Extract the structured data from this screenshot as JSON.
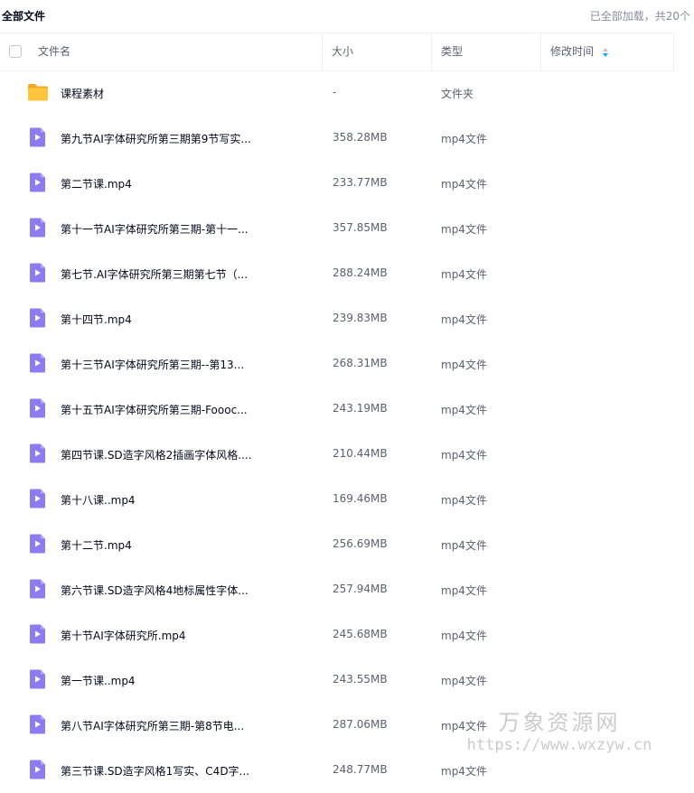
{
  "topbar": {
    "title": "全部文件",
    "loaded_text": "已全部加载，共20个"
  },
  "header": {
    "col_name": "文件名",
    "col_size": "大小",
    "col_type": "类型",
    "col_time": "修改时间"
  },
  "colors": {
    "folder": "#ffc53d",
    "video": "#8c7cf0",
    "sort_active": "#06a7ff"
  },
  "files": [
    {
      "icon": "folder-icon",
      "name": "课程素材",
      "size": "-",
      "type": "文件夹"
    },
    {
      "icon": "video-file-icon",
      "name": "第九节AI字体研究所第三期第9节写实...",
      "size": "358.28MB",
      "type": "mp4文件"
    },
    {
      "icon": "video-file-icon",
      "name": "第二节课.mp4",
      "size": "233.77MB",
      "type": "mp4文件"
    },
    {
      "icon": "video-file-icon",
      "name": "第十一节AI字体研究所第三期-第十一...",
      "size": "357.85MB",
      "type": "mp4文件"
    },
    {
      "icon": "video-file-icon",
      "name": "第七节.AI字体研究所第三期第七节（...",
      "size": "288.24MB",
      "type": "mp4文件"
    },
    {
      "icon": "video-file-icon",
      "name": "第十四节.mp4",
      "size": "239.83MB",
      "type": "mp4文件"
    },
    {
      "icon": "video-file-icon",
      "name": "第十三节AI字体研究所第三期--第13...",
      "size": "268.31MB",
      "type": "mp4文件"
    },
    {
      "icon": "video-file-icon",
      "name": "第十五节AI字体研究所第三期-Foooc...",
      "size": "243.19MB",
      "type": "mp4文件"
    },
    {
      "icon": "video-file-icon",
      "name": "第四节课.SD造字风格2插画字体风格....",
      "size": "210.44MB",
      "type": "mp4文件"
    },
    {
      "icon": "video-file-icon",
      "name": "第十八课..mp4",
      "size": "169.46MB",
      "type": "mp4文件"
    },
    {
      "icon": "video-file-icon",
      "name": "第十二节.mp4",
      "size": "256.69MB",
      "type": "mp4文件"
    },
    {
      "icon": "video-file-icon",
      "name": "第六节课.SD造字风格4地标属性字体...",
      "size": "257.94MB",
      "type": "mp4文件"
    },
    {
      "icon": "video-file-icon",
      "name": "第十节AI字体研究所.mp4",
      "size": "245.68MB",
      "type": "mp4文件"
    },
    {
      "icon": "video-file-icon",
      "name": "第一节课..mp4",
      "size": "243.55MB",
      "type": "mp4文件"
    },
    {
      "icon": "video-file-icon",
      "name": "第八节AI字体研究所第三期-第8节电...",
      "size": "287.06MB",
      "type": "mp4文件"
    },
    {
      "icon": "video-file-icon",
      "name": "第三节课.SD造字风格1写实、C4D字...",
      "size": "248.77MB",
      "type": "mp4文件"
    }
  ],
  "watermark": {
    "line1": "万象资源网",
    "line2": "https://www.wxzyw.cn"
  }
}
